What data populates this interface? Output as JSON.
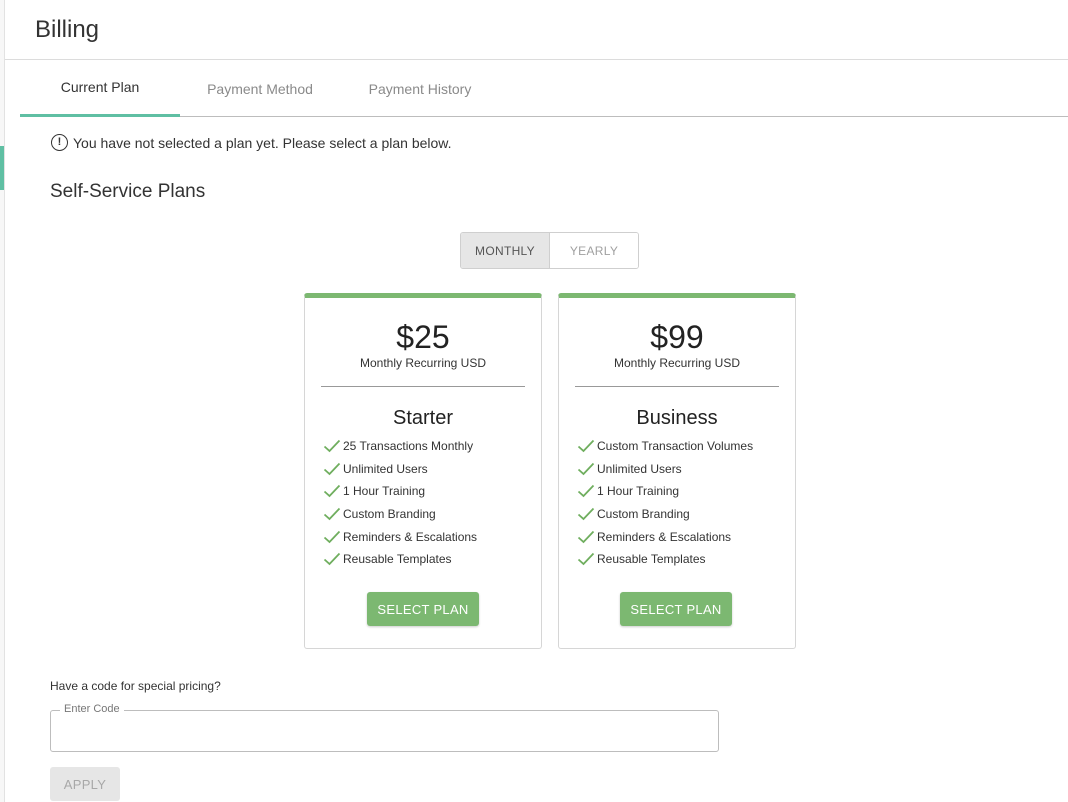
{
  "page": {
    "title": "Billing"
  },
  "tabs": [
    {
      "label": "Current Plan",
      "active": true
    },
    {
      "label": "Payment Method",
      "active": false
    },
    {
      "label": "Payment History",
      "active": false
    }
  ],
  "notice": {
    "icon": "info-circle-icon",
    "text": "You have not selected a plan yet. Please select a plan below."
  },
  "section_title": "Self-Service Plans",
  "billing_toggle": {
    "options": [
      "MONTHLY",
      "YEARLY"
    ],
    "selected": "MONTHLY"
  },
  "plans": [
    {
      "price": "$25",
      "recurring": "Monthly Recurring USD",
      "name": "Starter",
      "features": [
        "25 Transactions Monthly",
        "Unlimited Users",
        "1 Hour Training",
        "Custom Branding",
        "Reminders & Escalations",
        "Reusable Templates"
      ],
      "button_label": "SELECT PLAN"
    },
    {
      "price": "$99",
      "recurring": "Monthly Recurring USD",
      "name": "Business",
      "features": [
        "Custom Transaction Volumes",
        "Unlimited Users",
        "1 Hour Training",
        "Custom Branding",
        "Reminders & Escalations",
        "Reusable Templates"
      ],
      "button_label": "SELECT PLAN"
    }
  ],
  "promo": {
    "label": "Have a code for special pricing?",
    "field_label": "Enter Code",
    "value": "",
    "apply_label": "APPLY"
  },
  "colors": {
    "accent_teal": "#5fbfa3",
    "plan_green": "#7cb871",
    "check_green": "#6fae5e"
  }
}
